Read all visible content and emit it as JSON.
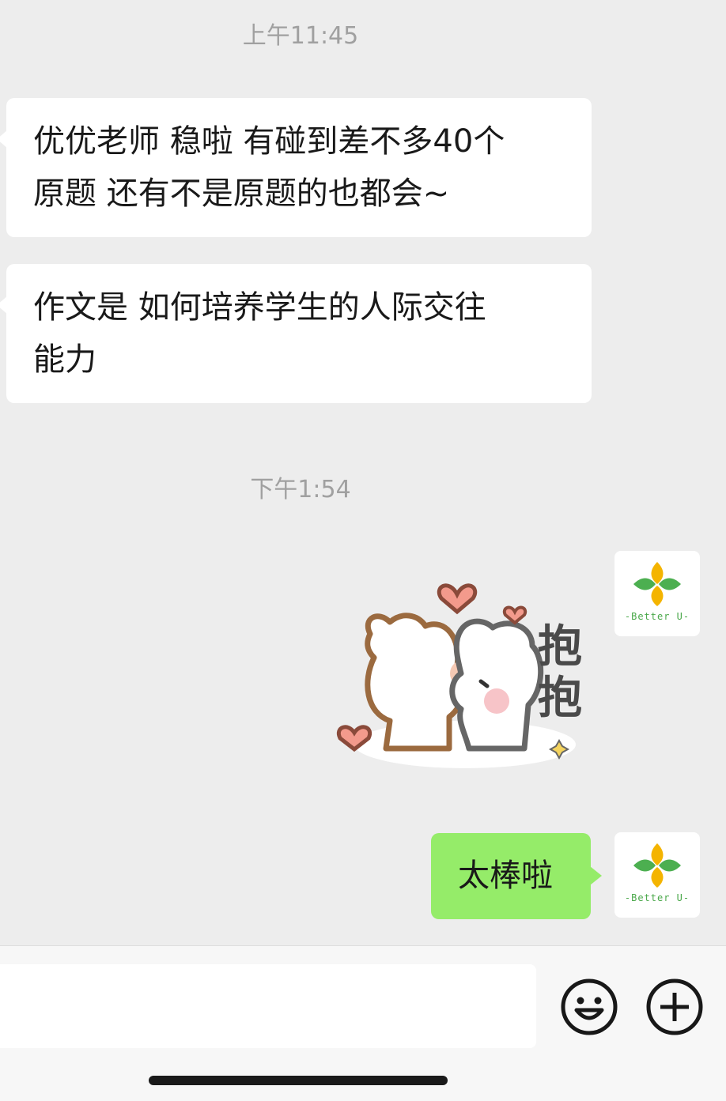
{
  "chat": {
    "timestamps": [
      "上午11:45",
      "下午1:54"
    ],
    "messages": [
      {
        "sender": "other",
        "lines": [
          "优优老师 稳啦 有碰到差不多40个",
          "原题 还有不是原题的也都会~"
        ]
      },
      {
        "sender": "other",
        "lines": [
          "作文是 如何培养学生的人际交往",
          "能力"
        ]
      },
      {
        "sender": "me",
        "type": "sticker",
        "sticker_text": [
          "抱",
          "抱"
        ]
      },
      {
        "sender": "me",
        "text": "太棒啦"
      }
    ],
    "avatar": {
      "label": "-Better U-",
      "icon": "better-u-logo"
    }
  },
  "input_bar": {
    "emoji_icon": "emoji-icon",
    "plus_icon": "plus-icon"
  },
  "colors": {
    "background": "#ededed",
    "bubble_in": "#ffffff",
    "bubble_out": "#95ec69",
    "timestamp": "#a0a0a0"
  }
}
